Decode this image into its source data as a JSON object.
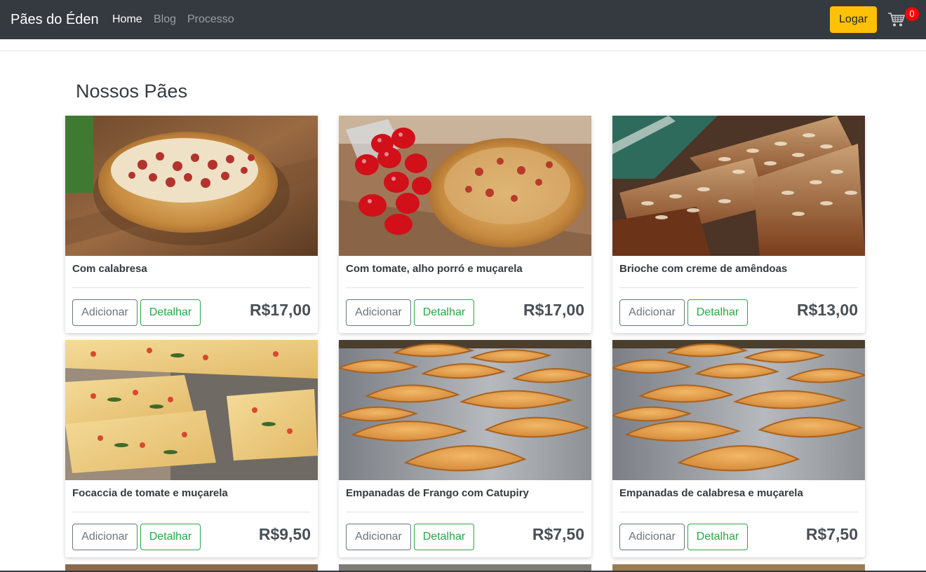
{
  "navbar": {
    "brand": "Pães do Éden",
    "links": [
      {
        "label": "Home",
        "active": true
      },
      {
        "label": "Blog",
        "active": false
      },
      {
        "label": "Processo",
        "active": false
      }
    ],
    "login_label": "Logar",
    "cart_icon": "shopping-cart-icon",
    "cart_count": "0"
  },
  "colors": {
    "navbar_bg": "#343a40",
    "login_btn": "#ffc107",
    "detail_btn": "#28a745",
    "badge": "#ff0000"
  },
  "section": {
    "title": "Nossos Pães"
  },
  "products": [
    {
      "name": "Com calabresa",
      "price": "R$17,00",
      "add_label": "Adicionar",
      "detail_label": "Detalhar",
      "image": "calabresa-bread-photo"
    },
    {
      "name": "Com tomate, alho porró e muçarela",
      "price": "R$17,00",
      "add_label": "Adicionar",
      "detail_label": "Detalhar",
      "image": "tomato-bread-photo"
    },
    {
      "name": "Brioche com creme de amêndoas",
      "price": "R$13,00",
      "add_label": "Adicionar",
      "detail_label": "Detalhar",
      "image": "almond-brioche-photo"
    },
    {
      "name": "Focaccia de tomate e muçarela",
      "price": "R$9,50",
      "add_label": "Adicionar",
      "detail_label": "Detalhar",
      "image": "focaccia-photo"
    },
    {
      "name": "Empanadas de Frango com Catupiry",
      "price": "R$7,50",
      "add_label": "Adicionar",
      "detail_label": "Detalhar",
      "image": "empanadas-photo"
    },
    {
      "name": "Empanadas de calabresa e muçarela",
      "price": "R$7,50",
      "add_label": "Adicionar",
      "detail_label": "Detalhar",
      "image": "empanadas-photo"
    }
  ]
}
